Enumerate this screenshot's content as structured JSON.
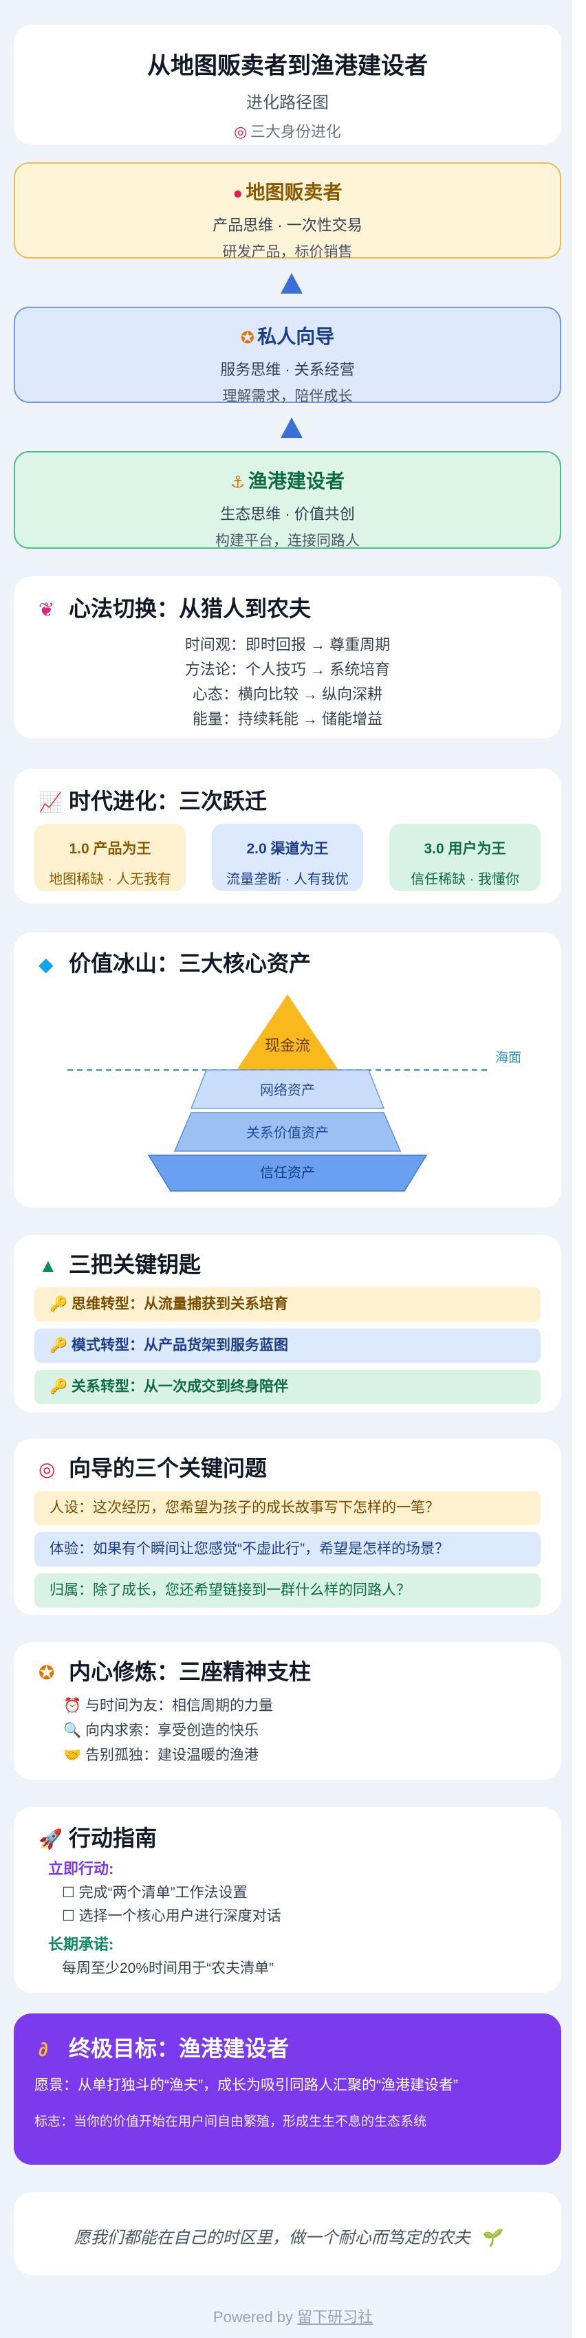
{
  "header": {
    "title": "从地图贩卖者到渔港建设者",
    "subtitle": "进化路径图",
    "tag": "三大身份进化",
    "tag_icon": "target-icon"
  },
  "stages": [
    {
      "name": "地图贩卖者",
      "line1": "产品思维 · 一次性交易",
      "line2": "研发产品，标价销售",
      "icon": "pin-icon",
      "bg": "#fdf4d8",
      "border": "#e8c04e",
      "color": "#8a5a00"
    },
    {
      "name": "私人向导",
      "line1": "服务思维 · 关系经营",
      "line2": "理解需求，陪伴成长",
      "icon": "compass-icon",
      "bg": "#dde9fb",
      "border": "#6f9ae0",
      "color": "#1d3f8a"
    },
    {
      "name": "渔港建设者",
      "line1": "生态思维 · 价值共创",
      "line2": "构建平台，连接同路人",
      "icon": "harbor-icon",
      "bg": "#dcf5e7",
      "border": "#49bd86",
      "color": "#0f6b47"
    }
  ],
  "mindset": {
    "icon": "brain-icon",
    "title": "心法切换：从猎人到农夫",
    "lines": [
      "时间观：即时回报 → 尊重周期",
      "方法论：个人技巧 → 系统培育",
      "心态：横向比较 → 纵向深耕",
      "能量：持续耗能 → 储能增益"
    ]
  },
  "eras": {
    "icon": "chart-icon",
    "title": "时代进化：三次跃迁",
    "items": [
      {
        "title": "1.0 产品为王",
        "desc": "地图稀缺 · 人无我有",
        "bg": "#fdf1cf",
        "color": "#8a5a00"
      },
      {
        "title": "2.0 渠道为王",
        "desc": "流量垄断 · 人有我优",
        "bg": "#dce8fb",
        "color": "#1d3f8a"
      },
      {
        "title": "3.0 用户为王",
        "desc": "信任稀缺 · 我懂你",
        "bg": "#d8f3e5",
        "color": "#0f6b47"
      }
    ]
  },
  "iceberg": {
    "icon": "diamond-icon",
    "title": "价值冰山：三大核心资产",
    "sea_label": "海面",
    "peak": "现金流",
    "layers": [
      "网络资产",
      "关系价值资产",
      "信任资产"
    ]
  },
  "keys": {
    "icon": "mountain-icon",
    "title": "三把关键钥匙",
    "items": [
      {
        "label": "思维转型：从流量捕获到关系培育",
        "bg": "#fdf1cf",
        "color": "#7a4d00"
      },
      {
        "label": "模式转型：从产品货架到服务蓝图",
        "bg": "#dce8fb",
        "color": "#1d3f8a"
      },
      {
        "label": "关系转型：从一次成交到终身陪伴",
        "bg": "#d8f3e5",
        "color": "#0f6b47"
      }
    ]
  },
  "questions": {
    "icon": "target-icon",
    "title": "向导的三个关键问题",
    "items": [
      {
        "text": "人设：这次经历，您希望为孩子的成长故事写下怎样的一笔？",
        "bg": "#fdf1cf",
        "color": "#7a4d00"
      },
      {
        "text": "体验：如果有个瞬间让您感觉“不虚此行”，希望是怎样的场景？",
        "bg": "#dce8fb",
        "color": "#1d3f8a"
      },
      {
        "text": "归属：除了成长，您还希望链接到一群什么样的同路人？",
        "bg": "#d8f3e5",
        "color": "#0f6b47"
      }
    ]
  },
  "inner": {
    "icon": "compass-icon",
    "title": "内心修炼：三座精神支柱",
    "items": [
      {
        "text": "与时间为友：相信周期的力量",
        "icon": "clock-icon"
      },
      {
        "text": "向内求索：享受创造的快乐",
        "icon": "magnifier-icon"
      },
      {
        "text": "告别孤独：建设温暖的渔港",
        "icon": "handshake-icon"
      }
    ]
  },
  "action": {
    "icon": "rocket-icon",
    "title": "行动指南",
    "now_label": "立即行动:",
    "now_items": [
      "完成“两个清单”工作法设置",
      "选择一个核心用户进行深度对话"
    ],
    "long_label": "长期承诺:",
    "long_text": "每周至少20%时间用于“农夫清单”"
  },
  "goal": {
    "icon": "ear-icon",
    "title": "终极目标：渔港建设者",
    "vision": "愿景：从单打独斗的“渔夫”，成长为吸引同路人汇聚的“渔港建设者”",
    "metric": "标志：当你的价值开始在用户间自由繁殖，形成生生不息的生态系统",
    "bg": "#7c3aed"
  },
  "closing": {
    "text": "愿我们都能在自己的时区里，做一个耐心而笃定的农夫",
    "icon": "seedling-icon"
  },
  "footer": {
    "prefix": "Powered by",
    "brand": "留下研习社"
  }
}
